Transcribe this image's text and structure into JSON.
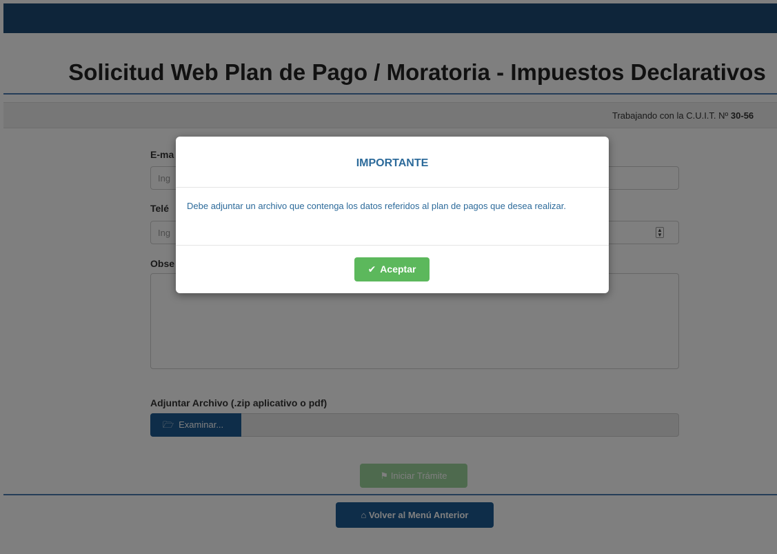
{
  "page": {
    "title": "Solicitud Web Plan de Pago / Moratoria - Impuestos Declarativos",
    "cuit_prefix": "Trabajando con la C.U.I.T. Nº ",
    "cuit_value": "30-56"
  },
  "form": {
    "email_label": "E-ma",
    "email_placeholder": "Ing",
    "phone_label": "Telé",
    "phone_placeholder": "Ing",
    "obs_label": "Obse",
    "attach_label": "Adjuntar Archivo (.zip aplicativo o pdf)",
    "browse_label": "Examinar...",
    "start_label": "Iniciar Trámite",
    "back_label": "Volver al Menú Anterior"
  },
  "modal": {
    "title": "IMPORTANTE",
    "message": "Debe adjuntar un archivo que contenga los datos referidos al plan de pagos que desea realizar.",
    "ok_label": "Aceptar"
  },
  "icons": {
    "folder": "folder-open-icon",
    "check": "check-icon",
    "home": "home-icon",
    "start": "flag-icon"
  },
  "colors": {
    "header": "#1c4a75",
    "primary": "#1c5a93",
    "success": "#5cb85c",
    "modal_text": "#2c6a9a"
  }
}
